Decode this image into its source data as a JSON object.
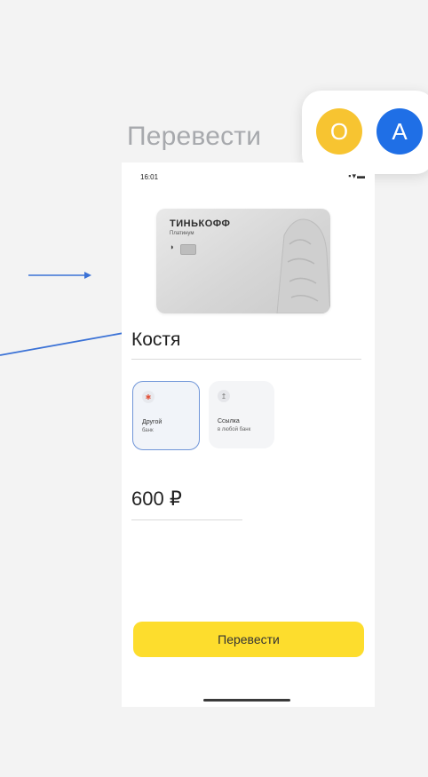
{
  "header": {
    "title": "Перевести"
  },
  "avatars": [
    {
      "letter": "O",
      "color": "#f7c431"
    },
    {
      "letter": "A",
      "color": "#1f6fe6"
    }
  ],
  "status_bar": {
    "time": "16:01",
    "icons": "▪▾▬"
  },
  "card": {
    "brand": "ТИНЬКОФФ",
    "tier": "Платинум",
    "contactless_icon": "contactless-icon"
  },
  "recipient": {
    "name": "Костя"
  },
  "options": [
    {
      "label_1": "Другой",
      "label_2": "банк",
      "icon": "bank-icon",
      "selected": true
    },
    {
      "label_1": "Ссылка",
      "label_2": "в любой банк",
      "icon": "link-icon",
      "selected": false
    }
  ],
  "amount": {
    "value": "600 ₽"
  },
  "action": {
    "label": "Перевести",
    "color": "#fddd2d"
  },
  "annotation": {
    "arrow_color": "#3b72d6"
  }
}
